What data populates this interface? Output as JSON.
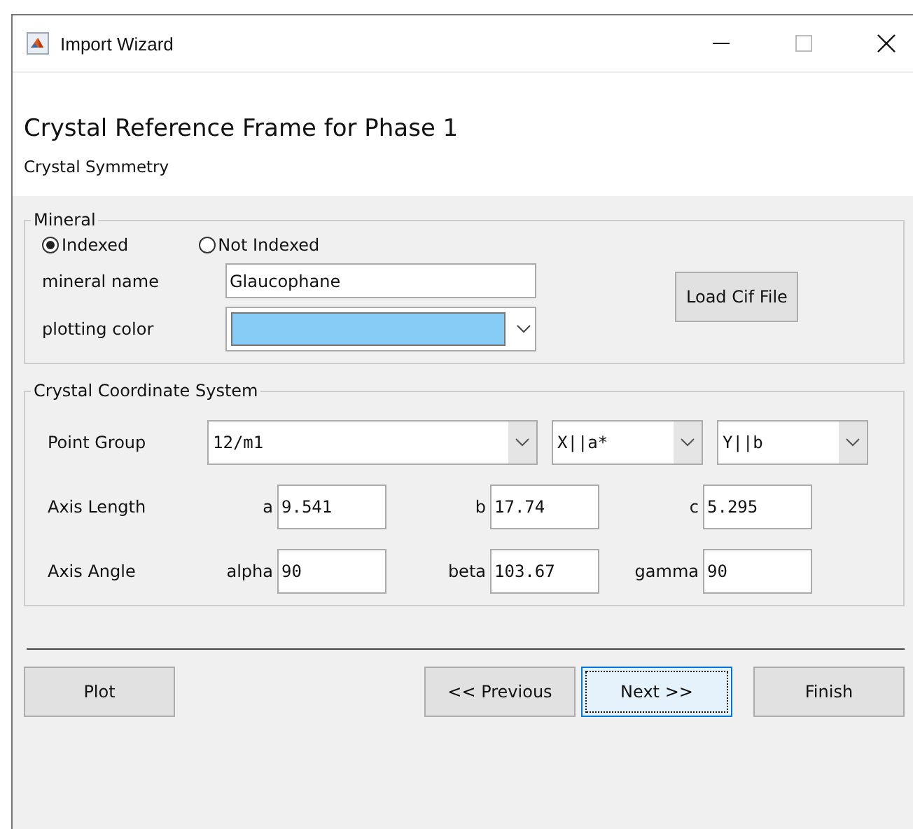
{
  "window": {
    "title": "Import Wizard"
  },
  "header": {
    "title": "Crystal Reference Frame for Phase 1",
    "subtitle": "Crystal Symmetry"
  },
  "mineral": {
    "legend": "Mineral",
    "radios": [
      {
        "label": "Indexed",
        "selected": true
      },
      {
        "label": "Not Indexed",
        "selected": false
      }
    ],
    "name_label": "mineral name",
    "name_value": "Glaucophane",
    "color_label": "plotting color",
    "color": "#87cbf7",
    "load_button": "Load Cif File"
  },
  "coordinate_system": {
    "legend": "Crystal Coordinate System",
    "point_group_label": "Point Group",
    "dropdowns": [
      {
        "value": "12/m1"
      },
      {
        "value": "X||a*"
      },
      {
        "value": "Y||b"
      }
    ],
    "rows": [
      {
        "label": "Axis Length",
        "fields": [
          {
            "label": "a",
            "value": "9.541"
          },
          {
            "label": "b",
            "value": "17.74"
          },
          {
            "label": "c",
            "value": "5.295"
          }
        ]
      },
      {
        "label": "Axis Angle",
        "fields": [
          {
            "label": "alpha",
            "value": "90"
          },
          {
            "label": "beta",
            "value": "103.67"
          },
          {
            "label": "gamma",
            "value": "90"
          }
        ]
      }
    ]
  },
  "buttons": [
    {
      "label": "Plot",
      "focused": false
    },
    {
      "label": "<< Previous",
      "focused": false
    },
    {
      "label": "Next >>",
      "focused": true
    },
    {
      "label": "Finish",
      "focused": false
    }
  ]
}
